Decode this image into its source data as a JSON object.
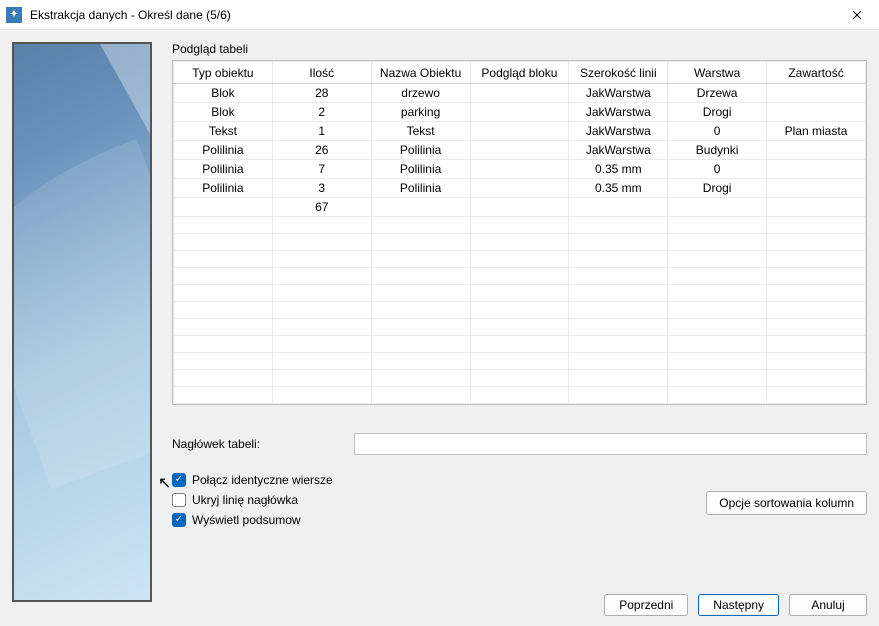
{
  "window": {
    "title": "Ekstrakcja danych - Określ dane (5/6)"
  },
  "labels": {
    "table_preview": "Podgląd tabeli",
    "table_header": "Nagłówek tabeli:"
  },
  "table": {
    "headers": [
      "Typ obiektu",
      "Ilość",
      "Nazwa Obiektu",
      "Podgląd bloku",
      "Szerokość linii",
      "Warstwa",
      "Zawartość"
    ],
    "rows": [
      {
        "c0": "Blok",
        "c1": "28",
        "c2": "drzewo",
        "c3": "",
        "c4": "JakWarstwa",
        "c5": "Drzewa",
        "c6": ""
      },
      {
        "c0": "Blok",
        "c1": "2",
        "c2": "parking",
        "c3": "",
        "c4": "JakWarstwa",
        "c5": "Drogi",
        "c6": ""
      },
      {
        "c0": "Tekst",
        "c1": "1",
        "c2": "Tekst",
        "c3": "",
        "c4": "JakWarstwa",
        "c5": "0",
        "c6": "Plan miasta"
      },
      {
        "c0": "Polilinia",
        "c1": "26",
        "c2": "Polilinia",
        "c3": "",
        "c4": "JakWarstwa",
        "c5": "Budynki",
        "c6": ""
      },
      {
        "c0": "Polilinia",
        "c1": "7",
        "c2": "Polilinia",
        "c3": "",
        "c4": "0.35 mm",
        "c5": "0",
        "c6": ""
      },
      {
        "c0": "Polilinia",
        "c1": "3",
        "c2": "Polilinia",
        "c3": "",
        "c4": "0.35 mm",
        "c5": "Drogi",
        "c6": ""
      },
      {
        "c0": "",
        "c1": "67",
        "c2": "",
        "c3": "",
        "c4": "",
        "c5": "",
        "c6": ""
      }
    ]
  },
  "checkboxes": {
    "merge_identical": {
      "label": "Połącz identyczne wiersze",
      "checked": true
    },
    "hide_header": {
      "label": "Ukryj linię nagłówka",
      "checked": false
    },
    "show_summary": {
      "label": "Wyświetl podsumow",
      "checked": true
    }
  },
  "buttons": {
    "sort_options": "Opcje sortowania kolumn",
    "previous": "Poprzedni",
    "next": "Następny",
    "cancel": "Anuluj"
  },
  "input": {
    "table_header_value": ""
  }
}
